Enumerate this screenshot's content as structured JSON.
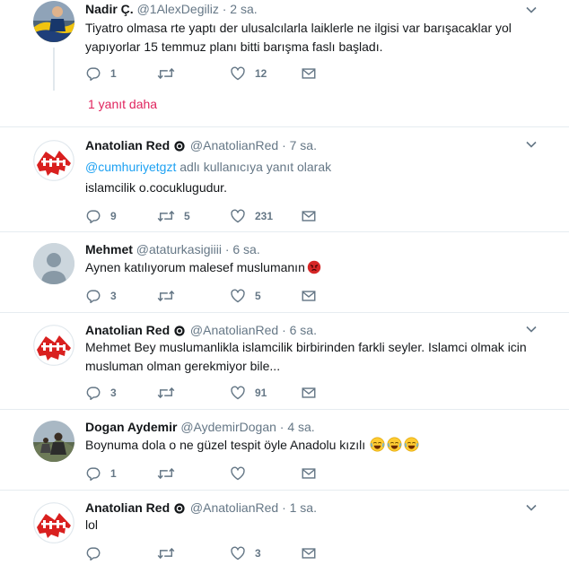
{
  "tweets": [
    {
      "name": "Nadir Ç.",
      "handle": "@1AlexDegiliz",
      "time": "· 2 sa.",
      "text": "Tiyatro olmasa rte yaptı der ulusalcılarla laiklerle ne ilgisi var barışacaklar yol yapıyorlar 15 temmuz planı bitti barışma faslı başladı.",
      "replies": "1",
      "retweets": "",
      "likes": "12",
      "more": "1 yanıt daha"
    },
    {
      "name": "Anatolian Red",
      "handle": "@AnatolianRed",
      "time": "· 7 sa.",
      "reply_mention": "@cumhuriyetgzt",
      "reply_suffix": " adlı kullanıcıya yanıt olarak",
      "text": "islamcilik o.cocuklugudur.",
      "replies": "9",
      "retweets": "5",
      "likes": "231"
    },
    {
      "name": "Mehmet",
      "handle": "@ataturkasigiiii",
      "time": "· 6 sa.",
      "text": "Aynen katılıyorum malesef muslumanın",
      "replies": "3",
      "retweets": "",
      "likes": "5"
    },
    {
      "name": "Anatolian Red",
      "handle": "@AnatolianRed",
      "time": "· 6 sa.",
      "text": "Mehmet Bey muslumanlikla islamcilik birbirinden farkli seyler. Islamci olmak icin musluman olman gerekmiyor bile...",
      "replies": "3",
      "retweets": "",
      "likes": "91"
    },
    {
      "name": "Dogan Aydemir",
      "handle": "@AydemirDogan",
      "time": "· 4 sa.",
      "text": "Boynuma dola o ne güzel tespit öyle Anadolu kızılı",
      "replies": "1",
      "retweets": "",
      "likes": ""
    },
    {
      "name": "Anatolian Red",
      "handle": "@AnatolianRed",
      "time": "· 1 sa.",
      "text": "lol",
      "replies": "",
      "retweets": "",
      "likes": "3"
    }
  ],
  "colors": {
    "link_blue": "#1da1f2",
    "secondary_gray": "#657786",
    "more_replies_red": "#e0245e",
    "anatolian_red": "#d9201f",
    "angry_emoji": "#d62626"
  }
}
